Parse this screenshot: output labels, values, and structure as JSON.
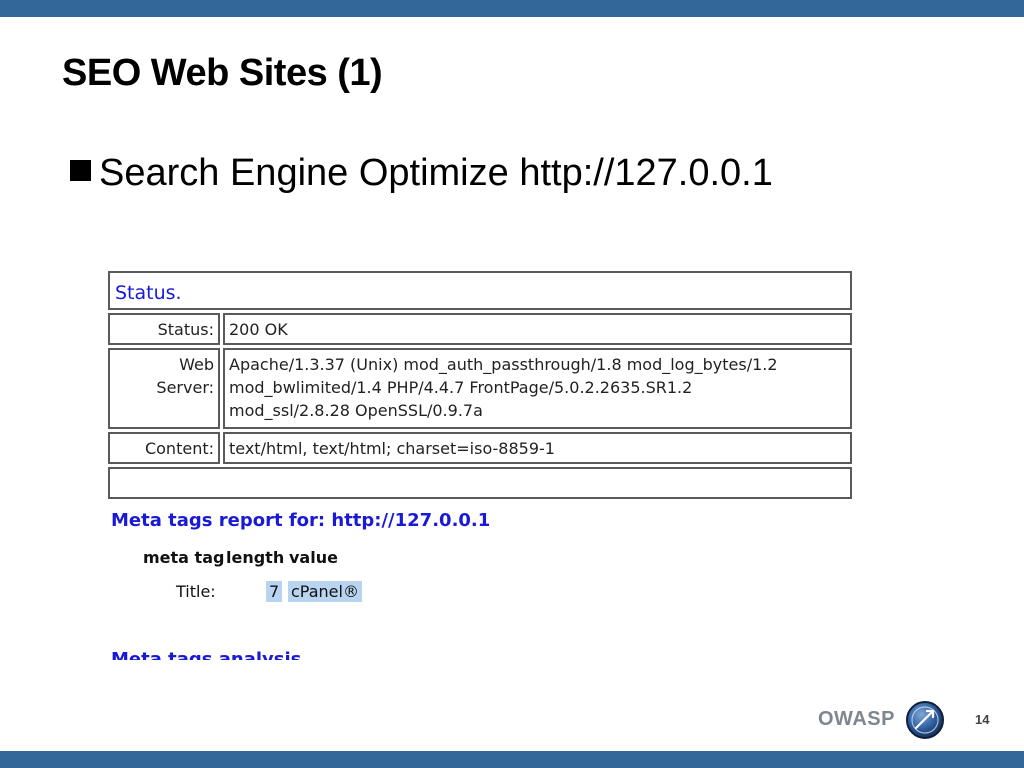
{
  "slide": {
    "title": "SEO Web Sites (1)",
    "bullet": "Search Engine Optimize http://127.0.0.1",
    "footer": {
      "brand": "OWASP",
      "logo_icon": "owasp-logo-icon",
      "page_number": "14"
    },
    "colors": {
      "bars": "#336699",
      "link_blue": "#1a1ad6",
      "highlight": "#b8d4f0"
    }
  },
  "screenshot": {
    "status_heading": "Status.",
    "rows": [
      {
        "label": "Status:",
        "value": "200 OK"
      },
      {
        "label_line1": "Web",
        "label_line2": "Server:",
        "value_line1": "Apache/1.3.37 (Unix) mod_auth_passthrough/1.8 mod_log_bytes/1.2",
        "value_line2": "mod_bwlimited/1.4 PHP/4.4.7 FrontPage/5.0.2.2635.SR1.2",
        "value_line3": "mod_ssl/2.8.28 OpenSSL/0.9.7a"
      },
      {
        "label": "Content:",
        "value": "text/html, text/html; charset=iso-8859-1"
      }
    ],
    "meta_heading": "Meta tags report for: http://127.0.0.1",
    "meta_columns": [
      "meta tag",
      "length",
      "value"
    ],
    "meta_rows": [
      {
        "tag": "Title:",
        "length": "7",
        "value": "cPanel®"
      }
    ],
    "cut_off_heading": "Meta tags analysis"
  }
}
